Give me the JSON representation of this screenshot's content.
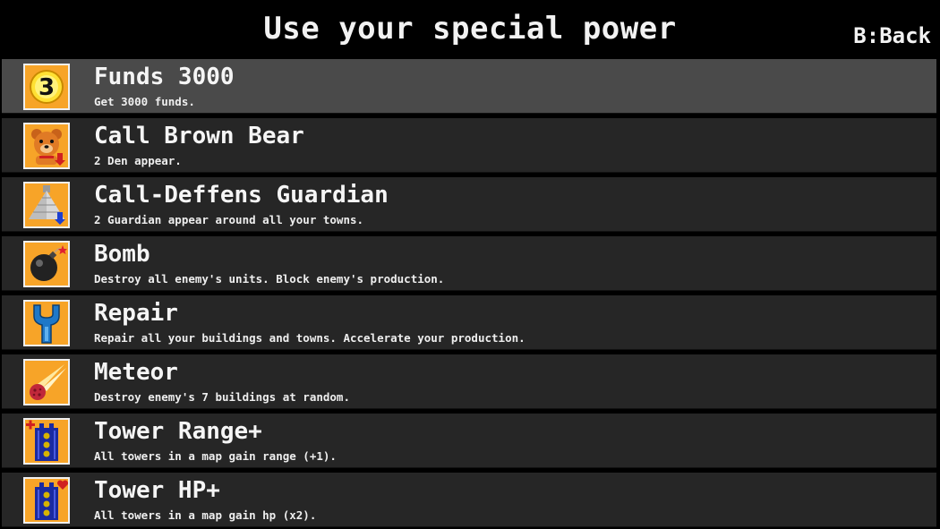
{
  "header": {
    "title": "Use your special power",
    "back_label": "B:Back"
  },
  "items": [
    {
      "name": "Funds 3000",
      "desc": "Get 3000 funds.",
      "icon": "coin-3-icon",
      "selected": true
    },
    {
      "name": "Call Brown Bear",
      "desc": "2 Den appear.",
      "icon": "brown-bear-icon",
      "selected": false
    },
    {
      "name": "Call-Deffens Guardian",
      "desc": "2 Guardian appear around all your towns.",
      "icon": "guardian-pyramid-icon",
      "selected": false
    },
    {
      "name": "Bomb",
      "desc": "Destroy all enemy's units. Block enemy's production.",
      "icon": "bomb-icon",
      "selected": false
    },
    {
      "name": "Repair",
      "desc": "Repair all your buildings and towns. Accelerate your production.",
      "icon": "wrench-icon",
      "selected": false
    },
    {
      "name": "Meteor",
      "desc": "Destroy enemy's 7 buildings at random.",
      "icon": "meteor-icon",
      "selected": false
    },
    {
      "name": "Tower Range+",
      "desc": "All towers in a map gain range (+1).",
      "icon": "tower-range-icon",
      "selected": false
    },
    {
      "name": "Tower HP+",
      "desc": "All towers in a map gain hp (x2).",
      "icon": "tower-hp-icon",
      "selected": false
    }
  ],
  "colors": {
    "icon_bg": "#f7a428",
    "row_bg": "#262626",
    "row_selected_bg": "#4a4a4a"
  }
}
